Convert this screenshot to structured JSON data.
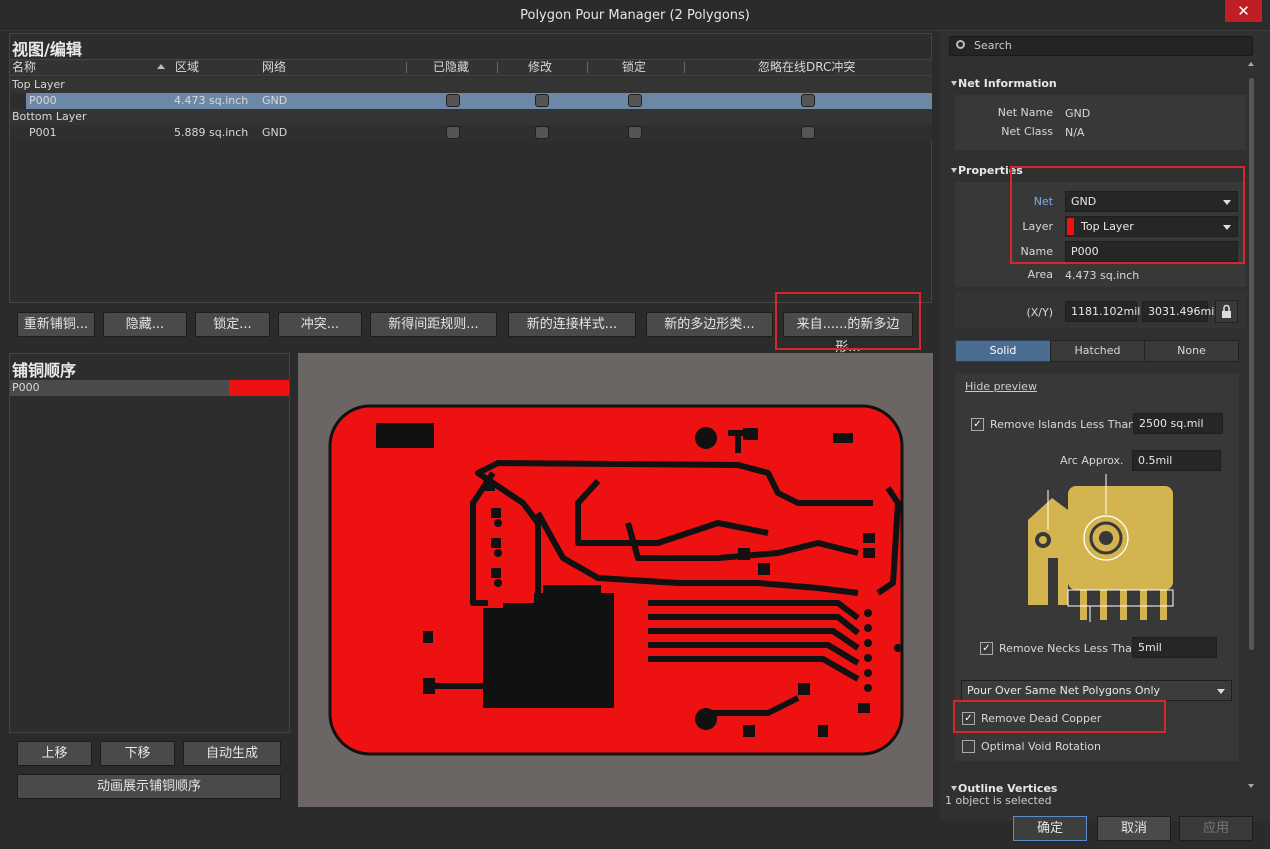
{
  "window": {
    "title": "Polygon Pour Manager (2 Polygons)",
    "close_glyph": "✕"
  },
  "view_edit": {
    "title": "视图/编辑",
    "columns": [
      "名称",
      "区域",
      "网络",
      "已隐藏",
      "修改",
      "锁定",
      "忽略在线DRC冲突"
    ],
    "groups": [
      {
        "layer": "Top Layer",
        "rows": [
          {
            "name": "P000",
            "area": "4.473 sq.inch",
            "net": "GND",
            "selected": true
          }
        ]
      },
      {
        "layer": "Bottom Layer",
        "rows": [
          {
            "name": "P001",
            "area": "5.889 sq.inch",
            "net": "GND",
            "selected": false
          }
        ]
      }
    ]
  },
  "action_buttons": [
    "重新铺铜...",
    "隐藏...",
    "锁定...",
    "冲突...",
    "新得间距规则...",
    "新的连接样式...",
    "新的多边形类...",
    "来自......的新多边形..."
  ],
  "pour_order": {
    "title": "铺铜顺序",
    "items": [
      {
        "name": "P000",
        "color": "#ee1111"
      }
    ],
    "buttons": {
      "up": "上移",
      "down": "下移",
      "auto": "自动生成",
      "animate": "动画展示铺铜顺序"
    }
  },
  "inspector": {
    "search_placeholder": "Search",
    "net_info": {
      "header": "Net Information",
      "net_name_label": "Net Name",
      "net_name": "GND",
      "net_class_label": "Net Class",
      "net_class": "N/A"
    },
    "properties": {
      "header": "Properties",
      "net_label": "Net",
      "net_value": "GND",
      "layer_label": "Layer",
      "layer_value": "Top Layer",
      "layer_color": "#ee1111",
      "name_label": "Name",
      "name_value": "P000",
      "area_label": "Area",
      "area_value": "4.473 sq.inch",
      "xy_label": "(X/Y)",
      "x_value": "1181.102mil",
      "y_value": "3031.496mi"
    },
    "fill_tabs": [
      "Solid",
      "Hatched",
      "None"
    ],
    "active_fill": "Solid",
    "hide_preview": "Hide preview",
    "remove_islands_label": "Remove Islands Less Than",
    "remove_islands_value": "2500 sq.mil",
    "arc_label": "Arc Approx.",
    "arc_value": "0.5mil",
    "remove_necks_label": "Remove Necks Less Than",
    "remove_necks_value": "5mil",
    "pour_over": "Pour Over Same Net Polygons Only",
    "remove_dead_copper": "Remove Dead Copper",
    "optimal_void": "Optimal Void Rotation",
    "outline_header": "Outline Vertices",
    "status": "1 object is selected",
    "check_glyph": "✓"
  },
  "footer": {
    "ok": "确定",
    "cancel": "取消",
    "apply": "应用"
  }
}
